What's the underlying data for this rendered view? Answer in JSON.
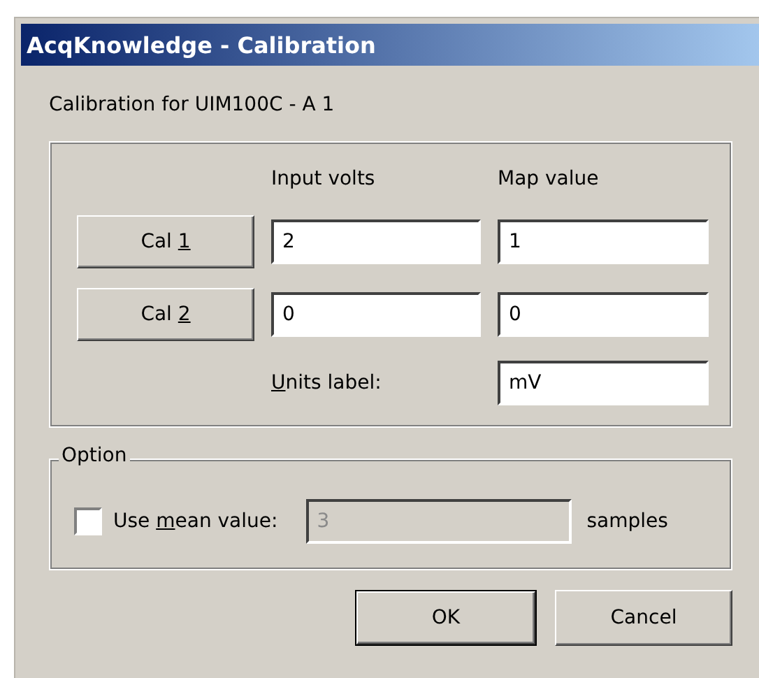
{
  "window": {
    "title": "AcqKnowledge - Calibration"
  },
  "heading": "Calibration for UIM100C - A 1",
  "calibration": {
    "columns": [
      "Input volts",
      "Map value"
    ],
    "rows": [
      {
        "button": [
          {
            "text": "Cal ",
            "underlined": false
          },
          {
            "text": "1",
            "underlined": true
          }
        ],
        "input_volts": "2",
        "map_value": "1"
      },
      {
        "button": [
          {
            "text": "Cal ",
            "underlined": false
          },
          {
            "text": "2",
            "underlined": true
          }
        ],
        "input_volts": "0",
        "map_value": "0"
      }
    ],
    "units": {
      "label": [
        {
          "text": "U",
          "underlined": true
        },
        {
          "text": "nits label:",
          "underlined": false
        }
      ],
      "value": "mV"
    }
  },
  "option": {
    "title": "Option",
    "checkbox": {
      "label": [
        {
          "text": "Use ",
          "underlined": false
        },
        {
          "text": "m",
          "underlined": true
        },
        {
          "text": "ean value:",
          "underlined": false
        }
      ],
      "checked": false
    },
    "samples_field": {
      "value": "3",
      "disabled": true
    },
    "suffix": "samples"
  },
  "buttons": [
    {
      "label": "OK",
      "default": true
    },
    {
      "label": "Cancel",
      "default": false
    }
  ]
}
